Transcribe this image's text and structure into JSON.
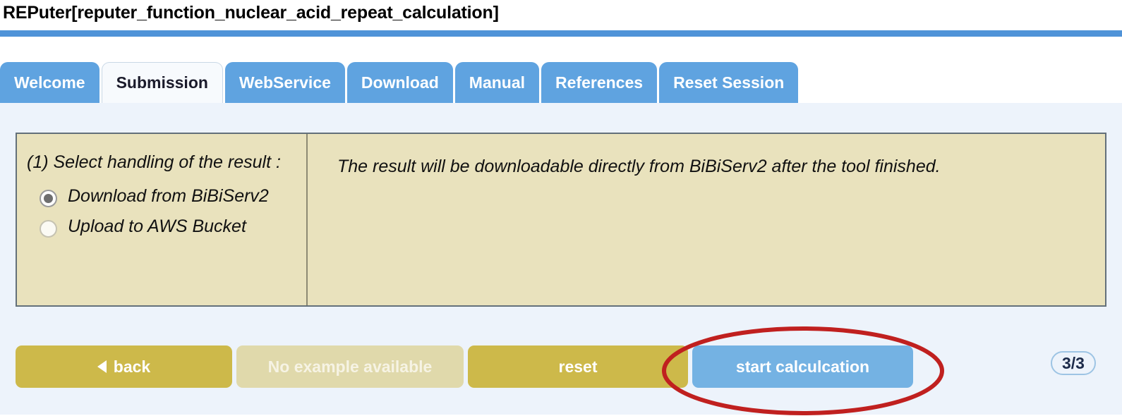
{
  "header": {
    "title": "REPuter[reputer_function_nuclear_acid_repeat_calculation]",
    "rule_color": "#4f93d8"
  },
  "tabs": [
    {
      "label": "Welcome",
      "active": false
    },
    {
      "label": "Submission",
      "active": true
    },
    {
      "label": "WebService",
      "active": false
    },
    {
      "label": "Download",
      "active": false
    },
    {
      "label": "Manual",
      "active": false
    },
    {
      "label": "References",
      "active": false
    },
    {
      "label": "Reset Session",
      "active": false
    }
  ],
  "form": {
    "question": "(1) Select handling of the result :",
    "options": [
      {
        "label": "Download from BiBiServ2",
        "selected": true
      },
      {
        "label": "Upload to AWS Bucket",
        "selected": false
      }
    ],
    "info_text": "The result will be downloadable directly from BiBiServ2 after the tool finished."
  },
  "buttons": {
    "back": "back",
    "back_icon": "triangle-left-icon",
    "example": "No example available",
    "reset": "reset",
    "start": "start calculcation"
  },
  "page_indicator": "3/3",
  "annotation": {
    "shape": "ellipse",
    "color": "#c0201f",
    "target": "start calculcation"
  },
  "colors": {
    "tab_blue": "#5fa3e0",
    "tab_active_bg": "#f7fafd",
    "panel_bg": "#e9e2bd",
    "panel_border": "#63707a",
    "content_bg": "#edf3fb",
    "button_gold": "#cdb94a",
    "button_gold_disabled": "#e0d9ab",
    "button_blue": "#74b2e3",
    "annotation_red": "#c0201f"
  }
}
